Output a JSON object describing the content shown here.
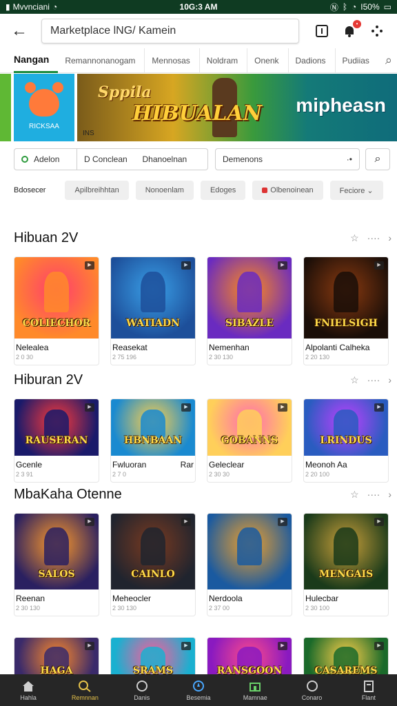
{
  "status": {
    "carrier": "Mvvnciani",
    "time": "10G:3 AM",
    "battery": "I50%"
  },
  "topbar": {
    "search_value": "Marketplace lNG/ Kamein"
  },
  "tabs": [
    {
      "label": "Nangan",
      "active": true
    },
    {
      "label": "Remannonanogam"
    },
    {
      "label": "Mennosas"
    },
    {
      "label": "Noldram"
    },
    {
      "label": "Onenk"
    },
    {
      "label": "Dadions"
    },
    {
      "label": "Pudiias"
    }
  ],
  "banner": {
    "small_card_label": "RICKSAA",
    "subtitle": "Sppila",
    "title": "HIBUALAN",
    "brand": "mipheasn",
    "corner_text": "INS"
  },
  "filters": {
    "radio_label": "Adelon",
    "seg_a": "D Conclean",
    "seg_b": "Dhanoelnan",
    "dropdown_value": "Demenons",
    "dropdown_suffix": "·•"
  },
  "chips": {
    "label": "Bdosecer",
    "items": [
      "Apilbreihhtan",
      "Nonoenlam",
      "Edoges",
      "Olbenoinean",
      "Feciore ⌄"
    ]
  },
  "sections": [
    {
      "title": "Hibuan 2V",
      "cards": [
        {
          "name": "Nelealea",
          "meta": "2 0 30",
          "caption": "COLIECHOR",
          "c1": "#ff8a2a",
          "c2": "#ff3d6e"
        },
        {
          "name": "Reasekat",
          "meta": "2 75 196",
          "caption": "WATIADN",
          "c1": "#1d4f9a",
          "c2": "#3aa0e8"
        },
        {
          "name": "Nemenhan",
          "meta": "2 30 130",
          "caption": "SIBAZLE",
          "c1": "#6a2bc0",
          "c2": "#ff8a1a"
        },
        {
          "name": "Alpolanti Calheka",
          "meta": "2 20 130",
          "caption": "FNIELSIGH",
          "c1": "#1a0e08",
          "c2": "#8a3a10"
        }
      ]
    },
    {
      "title": "Hiburan 2V",
      "cards": [
        {
          "name": "Gcenle",
          "meta": "2 3 91",
          "caption": "RAUSERAN",
          "c1": "#1a1a6a",
          "c2": "#ff3a3a"
        },
        {
          "name": "Fwluoran",
          "name_right": "Rar",
          "meta": "2 7 0",
          "caption": "HBNBAAN",
          "c1": "#1a8ad0",
          "c2": "#ffd04a"
        },
        {
          "name": "Geleclear",
          "meta": "2 30 30",
          "caption": "GOBANNS",
          "c1": "#ffcf5a",
          "c2": "#ff6ab0"
        },
        {
          "name": "Meonoh Aa",
          "meta": "2 20 100",
          "caption": "LRINDUS",
          "c1": "#2a5cc0",
          "c2": "#c040ff"
        }
      ]
    },
    {
      "title": "MbaKaha Otenne",
      "cards": [
        {
          "name": "Reenan",
          "meta": "2 30 130",
          "caption": "SALOS",
          "c1": "#2a2060",
          "c2": "#ff9a2a"
        },
        {
          "name": "Meheocler",
          "meta": "2 30 130",
          "caption": "CAINLO",
          "c1": "#20242e",
          "c2": "#7a3a20"
        },
        {
          "name": "Nerdoola",
          "meta": "2 37 00",
          "caption": "",
          "c1": "#1a5aa0",
          "c2": "#f0a02a"
        },
        {
          "name": "Hulecbar",
          "meta": "2 30 100",
          "caption": "MENGAIS",
          "c1": "#1a3a1a",
          "c2": "#caa03a"
        }
      ]
    },
    {
      "title": "",
      "cards": [
        {
          "name": "",
          "meta": "",
          "caption": "HAGA",
          "c1": "#3a2a6a",
          "c2": "#ff8a2a"
        },
        {
          "name": "",
          "meta": "",
          "caption": "SRAMS",
          "c1": "#1ab0d0",
          "c2": "#ff5a9a"
        },
        {
          "name": "",
          "meta": "",
          "caption": "RANSGOON",
          "c1": "#8a1ac0",
          "c2": "#ff4a8a"
        },
        {
          "name": "",
          "meta": "",
          "caption": "CASAREMS",
          "c1": "#1a6a2a",
          "c2": "#ffd04a"
        }
      ]
    }
  ],
  "bottomnav": [
    {
      "label": "Hahla",
      "icon": "home-icon"
    },
    {
      "label": "Remnnan",
      "icon": "search-icon",
      "active": true
    },
    {
      "label": "Danis",
      "icon": "circle-icon"
    },
    {
      "label": "Besemia",
      "icon": "compass-icon"
    },
    {
      "label": "Mamnae",
      "icon": "store-icon"
    },
    {
      "label": "Conaro",
      "icon": "profile-icon"
    },
    {
      "label": "Flant",
      "icon": "news-icon"
    }
  ]
}
